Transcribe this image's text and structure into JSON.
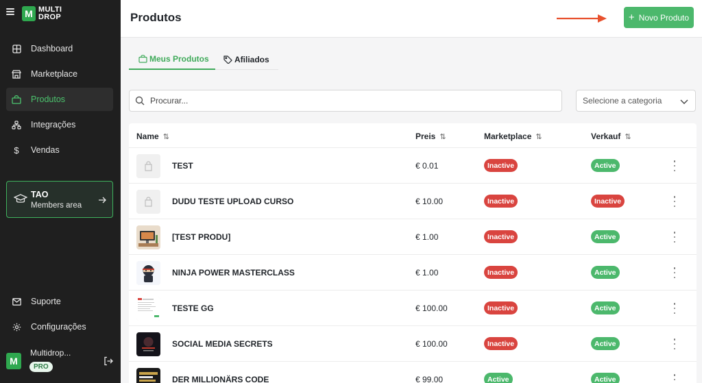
{
  "brand": {
    "logo_letter": "M",
    "line1": "MULTI",
    "line2": "DROP",
    "color": "#2fa84f"
  },
  "sidebar": {
    "items": [
      {
        "label": "Dashboard",
        "icon": "dashboard-icon"
      },
      {
        "label": "Marketplace",
        "icon": "store-icon"
      },
      {
        "label": "Produtos",
        "icon": "bag-icon",
        "active": true
      },
      {
        "label": "Integrações",
        "icon": "integrations-icon"
      },
      {
        "label": "Vendas",
        "icon": "dollar-icon"
      }
    ],
    "members": {
      "title": "TAO",
      "subtitle": "Members area"
    },
    "bottom_items": [
      {
        "label": "Suporte",
        "icon": "mail-icon"
      },
      {
        "label": "Configurações",
        "icon": "gear-icon"
      }
    ],
    "user": {
      "avatar_letter": "M",
      "name": "Multidrop...",
      "plan": "PRO"
    }
  },
  "header": {
    "title": "Produtos",
    "new_button": "Novo Produto"
  },
  "tabs": [
    {
      "label": "Meus Produtos",
      "active": true
    },
    {
      "label": "Afiliados",
      "active": false
    }
  ],
  "search": {
    "placeholder": "Procurar..."
  },
  "category": {
    "selected": "Selecione a categoria"
  },
  "table": {
    "columns": [
      "Name",
      "Preis",
      "Marketplace",
      "Verkauf"
    ],
    "rows": [
      {
        "name": "TEST",
        "price": "€ 0.01",
        "marketplace": "Inactive",
        "sale": "Active",
        "thumb": "placeholder"
      },
      {
        "name": "DUDU TESTE UPLOAD CURSO",
        "price": "€ 10.00",
        "marketplace": "Inactive",
        "sale": "Inactive",
        "thumb": "placeholder"
      },
      {
        "name": "[TEST PRODU]",
        "price": "€ 1.00",
        "marketplace": "Inactive",
        "sale": "Active",
        "thumb": "desk"
      },
      {
        "name": "NINJA POWER MASTERCLASS",
        "price": "€ 1.00",
        "marketplace": "Inactive",
        "sale": "Active",
        "thumb": "ninja"
      },
      {
        "name": "TESTE GG",
        "price": "€ 100.00",
        "marketplace": "Inactive",
        "sale": "Active",
        "thumb": "document"
      },
      {
        "name": "SOCIAL MEDIA SECRETS",
        "price": "€ 100.00",
        "marketplace": "Inactive",
        "sale": "Active",
        "thumb": "dark-cover"
      },
      {
        "name": "DER MILLIONÄRS CODE",
        "price": "€ 99.00",
        "marketplace": "Active",
        "sale": "Active",
        "thumb": "book-cover"
      }
    ]
  },
  "colors": {
    "active": "#4cb86c",
    "inactive": "#d9443f",
    "accent": "#3faa5a",
    "annotation_arrow": "#e8512e"
  }
}
